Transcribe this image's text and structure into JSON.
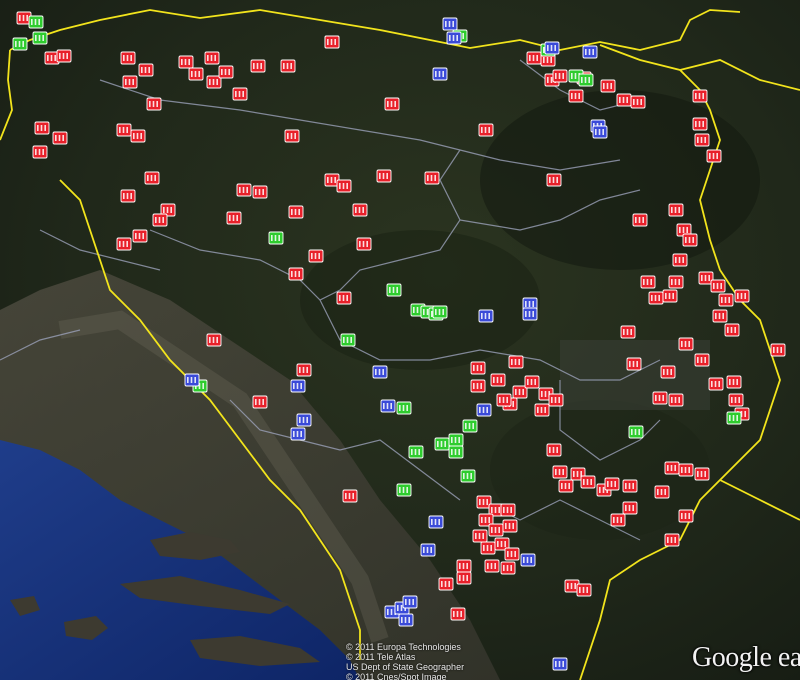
{
  "map": {
    "colors": {
      "red": "#e8202a",
      "green": "#2ecc2e",
      "blue": "#3a4ad8",
      "border": "#f2e41c",
      "admin": "#9aa0b8"
    },
    "icons": {
      "red": "red-mosque-marker-icon",
      "green": "green-building-marker-icon",
      "blue": "blue-building-marker-icon"
    }
  },
  "attribution": {
    "lines": [
      "© 2011 Europa Technologies",
      "© 2011 Tele Atlas",
      "US Dept of State Geographer",
      "© 2011 Cnes/Spot Image"
    ]
  },
  "logo": {
    "text": "Google ea"
  }
}
